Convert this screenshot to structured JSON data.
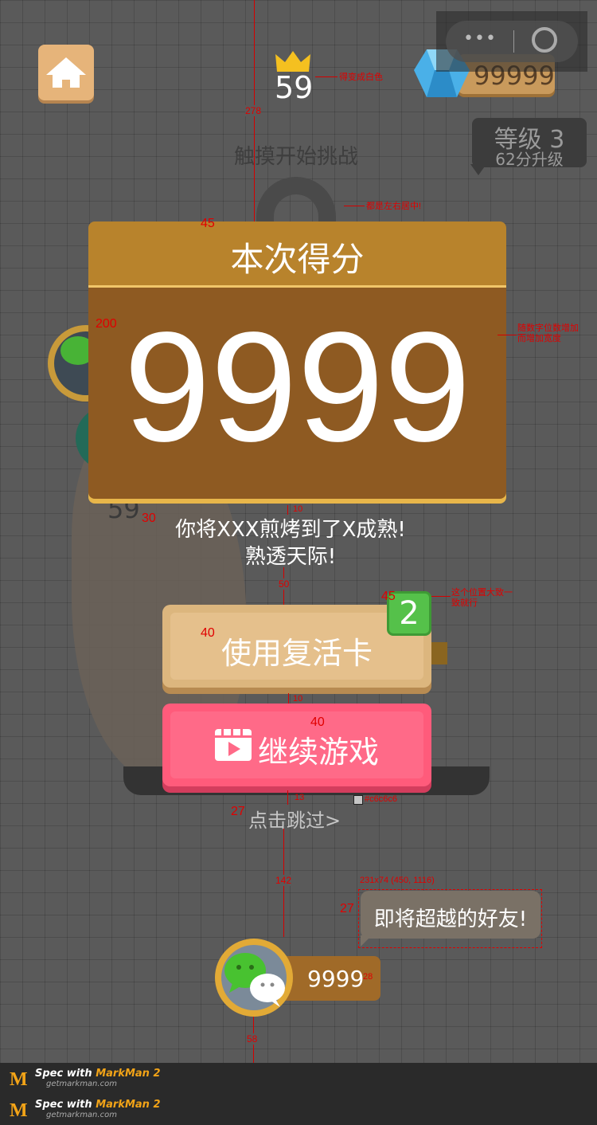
{
  "hud": {
    "best_score": "59",
    "best_note": "得变成白色",
    "gems": "99999",
    "level": "等级 3",
    "level_up": "62分升级",
    "touch_hint": "触摸开始挑战",
    "center_note": "都是左右居中!",
    "width_note_1": "随数字位数增加",
    "width_note_2": "而增加宽度"
  },
  "panel": {
    "title": "本次得分",
    "score": "9999",
    "msg_line1": "你将XXX煎烤到了X成熟!",
    "msg_line2": "熟透天际!"
  },
  "buttons": {
    "revive_label": "使用复活卡",
    "revive_count": "2",
    "revive_note_1": "这个位置大致一",
    "revive_note_2": "致就行",
    "continue_label": "继续游戏",
    "skip_label": "点击跳过>",
    "skip_color": "#c6c6c6"
  },
  "friend": {
    "tooltip": "即将超越的好友!",
    "tooltip_spec": "231x74 (450, 1116)",
    "score": "9999",
    "bg_score": "59"
  },
  "spec_dims": {
    "d278": "278",
    "d45a": "45",
    "d200": "200",
    "d10a": "10",
    "d30": "30",
    "d50": "50",
    "d45b": "45",
    "d40a": "40",
    "d10b": "10",
    "d40b": "40",
    "d13": "13",
    "d27a": "27",
    "d142": "142",
    "d27b": "27",
    "d28": "28",
    "d58": "58"
  },
  "footer": {
    "brand_prefix": "Spec with ",
    "brand_name": "MarkMan 2",
    "site": "getmarkman.com"
  },
  "colors": {
    "panel_header": "#b8832c",
    "panel_body": "#8e5a22",
    "revive_btn": "#dcb67e",
    "continue_btn": "#ff5b7b",
    "badge": "#55c14a"
  }
}
